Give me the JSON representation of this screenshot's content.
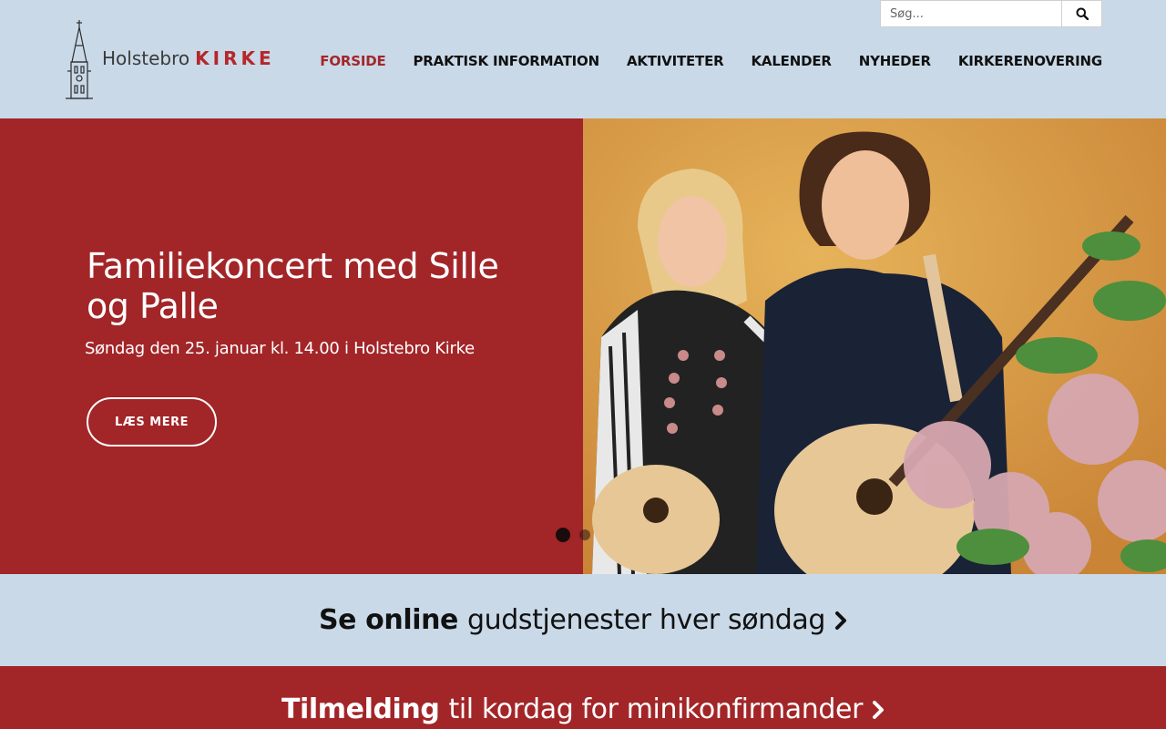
{
  "brand": {
    "name_prefix": "Holstebro",
    "name_suffix": "KIRKE"
  },
  "search": {
    "placeholder": "Søg..."
  },
  "nav": {
    "items": [
      {
        "label": "FORSIDE",
        "active": true
      },
      {
        "label": "PRAKTISK INFORMATION"
      },
      {
        "label": "AKTIVITETER"
      },
      {
        "label": "KALENDER"
      },
      {
        "label": "NYHEDER"
      },
      {
        "label": "KIRKERENOVERING"
      }
    ]
  },
  "hero": {
    "title": "Familiekoncert med Sille og Palle",
    "subtitle": "Søndag den 25. januar kl. 14.00 i Holstebro Kirke",
    "button_label": "LÆS MERE",
    "slides_total": 2,
    "active_slide": 1
  },
  "banners": [
    {
      "bold": "Se online",
      "rest": "gudstjenester hver søndag"
    },
    {
      "bold": "Tilmelding",
      "rest": "til kordag for minikonfirmander"
    }
  ],
  "colors": {
    "accent": "#a22528",
    "header_bg": "#c9d9e8",
    "active_nav": "#a4262a"
  },
  "icons": [
    "church-tower-logo-icon",
    "search-icon",
    "chevron-right-icon"
  ]
}
